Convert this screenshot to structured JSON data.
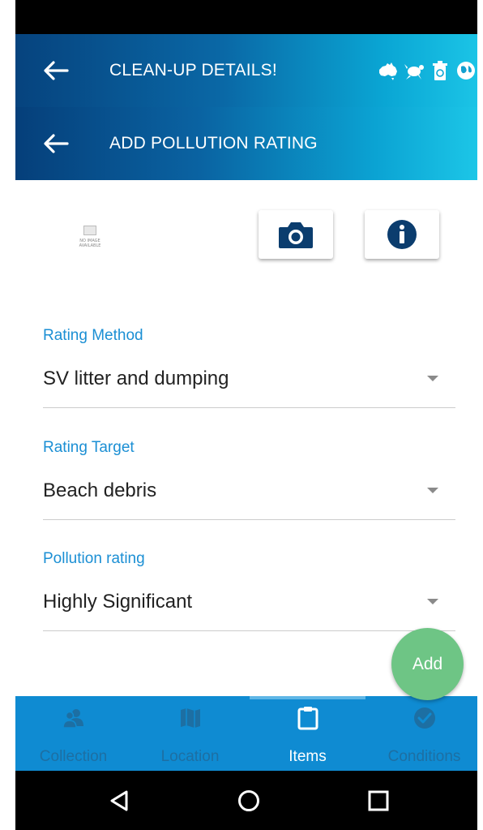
{
  "header": {
    "title": "CLEAN-UP DETAILS!",
    "icons": [
      "australia-map-icon",
      "turtle-icon",
      "recycle-bin-icon",
      "earth-icon"
    ]
  },
  "subheader": {
    "title": "ADD POLLUTION RATING"
  },
  "image_placeholder": {
    "line1": "NO IMAGE",
    "line2": "AVAILABLE"
  },
  "fields": [
    {
      "label": "Rating Method",
      "value": "SV litter and dumping"
    },
    {
      "label": "Rating Target",
      "value": "Beach debris"
    },
    {
      "label": "Pollution rating",
      "value": "Highly Significant"
    }
  ],
  "fab": {
    "label": "Add",
    "color": "#6ec585"
  },
  "bottom_nav": {
    "active_index": 2,
    "items": [
      {
        "label": "Collection",
        "icon": "people-icon"
      },
      {
        "label": "Location",
        "icon": "map-icon"
      },
      {
        "label": "Items",
        "icon": "clipboard-icon"
      },
      {
        "label": "Conditions",
        "icon": "check-circle-icon"
      }
    ]
  },
  "colors": {
    "header_start": "#06437e",
    "header_end": "#1bc4e6",
    "label_blue": "#1b8fd4",
    "nav_bg": "#0f8bd2",
    "icon_navy": "#0b3d6e"
  }
}
